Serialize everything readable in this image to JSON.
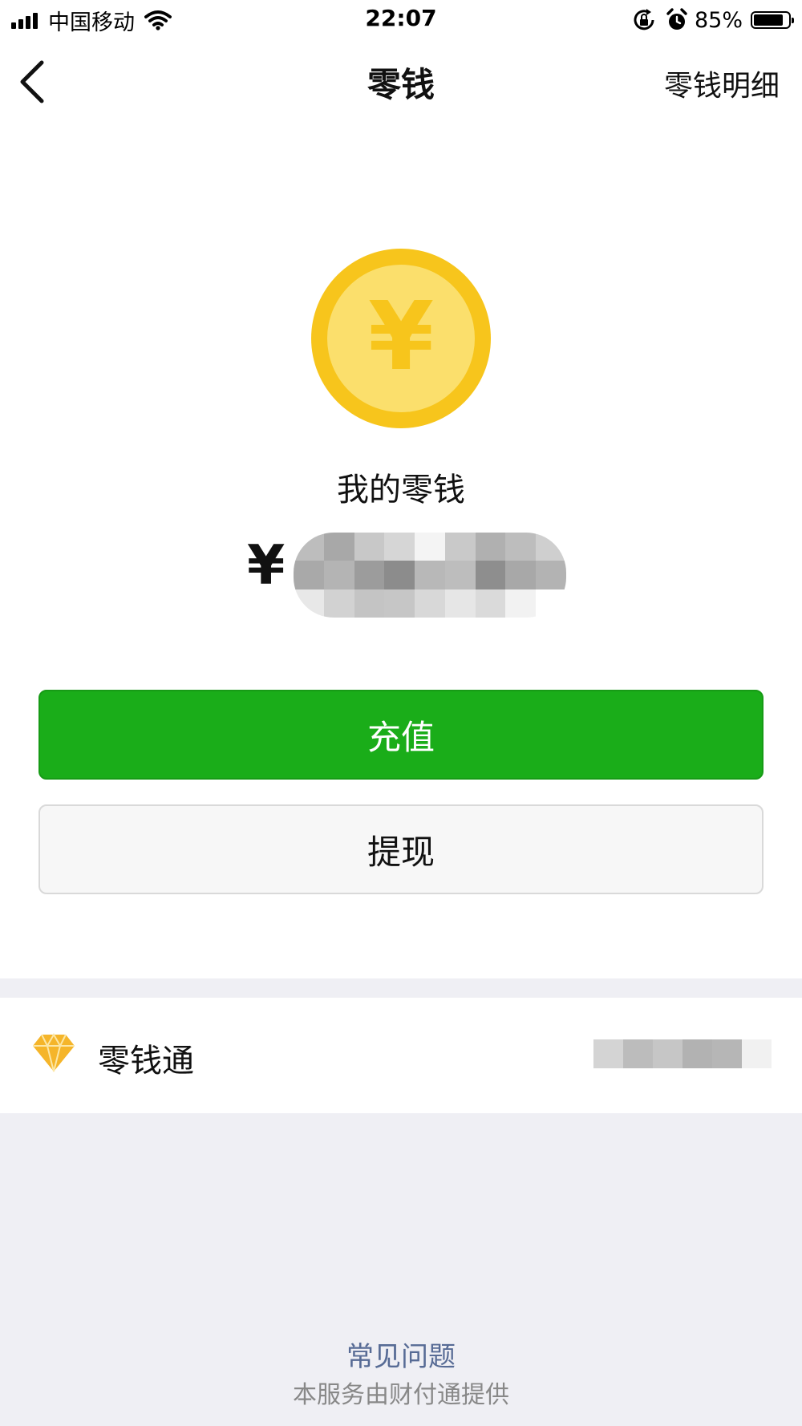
{
  "status_bar": {
    "carrier": "中国移动",
    "time": "22:07",
    "battery_percent": "85%",
    "battery_level": 0.85,
    "icons": [
      "signal-icon",
      "wifi-icon",
      "rotation-lock-icon",
      "alarm-icon",
      "battery-icon"
    ]
  },
  "nav": {
    "title": "零钱",
    "right_link": "零钱明细",
    "back_icon": "chevron-left-icon"
  },
  "wallet": {
    "coin_icon": "yen-coin-icon",
    "coin_symbol": "¥",
    "label": "我的零钱",
    "currency": "¥",
    "amount_obscured": true
  },
  "actions": {
    "recharge": "充值",
    "withdraw": "提现"
  },
  "list": {
    "items": [
      {
        "label": "零钱通",
        "icon": "diamond-icon",
        "value_obscured": true
      }
    ]
  },
  "footer": {
    "faq": "常见问题",
    "provider": "本服务由财付通提供"
  },
  "colors": {
    "primary_green": "#1aad19",
    "link_blue": "#576b95",
    "coin_outer": "#f7c51c",
    "coin_inner": "#fbdf6c",
    "gem_gold": "#f5b52a",
    "page_grey": "#efeff4"
  }
}
